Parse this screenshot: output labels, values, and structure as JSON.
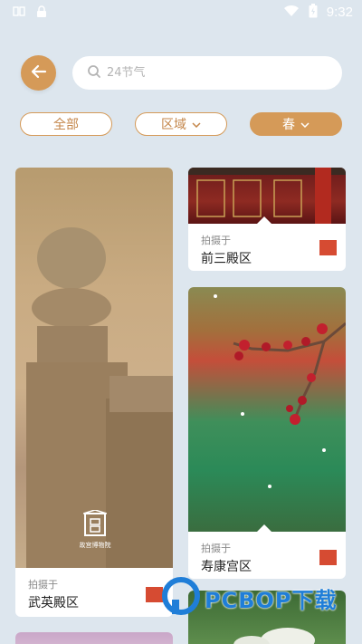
{
  "status_bar": {
    "time": "9:32",
    "icons": [
      "notification-icon",
      "lock-icon",
      "wifi-icon",
      "battery-icon"
    ]
  },
  "header": {
    "back_icon": "arrow-left-icon",
    "search": {
      "placeholder": "24节气",
      "value": ""
    }
  },
  "filters": {
    "all": "全部",
    "region": "区域",
    "season": "春"
  },
  "colors": {
    "accent": "#d59a58",
    "background": "#dde6ee",
    "swatch_red": "#d64b32"
  },
  "cards": [
    {
      "label": "拍摄于",
      "place": "武英殿区",
      "swatch": "#d64b32"
    },
    {
      "label": "拍摄于",
      "place": "前三殿区",
      "swatch": "#d64b32"
    },
    {
      "label": "拍摄于",
      "place": "寿康宫区",
      "swatch": "#d64b32"
    }
  ],
  "logo": {
    "text": "故宫博物院"
  },
  "watermark": {
    "text": "PCBOP下载"
  }
}
